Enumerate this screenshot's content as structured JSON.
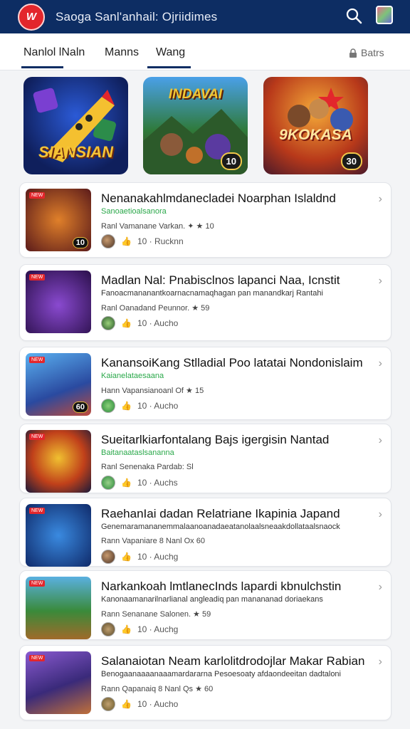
{
  "header": {
    "logo_text": "W",
    "title": "Saoga Sanl'anhail: Ojriidimes"
  },
  "tabs": [
    {
      "label": "Nanlol lNaln"
    },
    {
      "label": "Manns"
    },
    {
      "label": "Wang"
    }
  ],
  "tab_side": {
    "label": "Batrs"
  },
  "featured": [
    {
      "label": "SIANSIAN",
      "badge": ""
    },
    {
      "label": "INDAVAI",
      "badge": "10"
    },
    {
      "label": "9KOKASA",
      "badge": "30"
    }
  ],
  "cards": [
    {
      "title": "Nenanakahlmdanecladei Noarphan Islaldnd",
      "sub": "Sanoaetioalsanora",
      "meta": "Ranl Vamanane Varkan. ✦ ★ 10",
      "foot": "10   ·   Rucknn",
      "badge": "10"
    },
    {
      "title": "Madlan Nal: Pnabisclnos lapanci Naa, Icnstit",
      "sub": "Fanoacmananantkoarnacnamaqhagan pan manandkarj Rantahi",
      "meta": "Ranl Oanadand Peunnor. ★ 59",
      "foot": "10   ·   Aucho",
      "badge": ""
    },
    {
      "title": "KanansoiKang Stlladial Poo latatai Nondonislaim",
      "sub": "Kaianelataesaana",
      "meta": "Hann Vapansianoanl Of ★ 15",
      "foot": "10   ·   Aucho",
      "badge": "60"
    },
    {
      "title": "Sueitarlkiarfontalang Bajs igergisin Nantad",
      "sub": "Baitanaataslsananna",
      "meta": "Ranl Senenaka Pardab: Sl",
      "foot": "10   ·   Auchs",
      "badge": ""
    },
    {
      "title": "RaehanIai dadan Relatriane Ikapinia Japand",
      "sub": "Genemaramananemmalaanoanadaeatanolaalsneaakdollataalsnaock",
      "meta": "Rann Vapaniare 8 Nanl Ox 60",
      "foot": "10   ·   Auchg",
      "badge": ""
    },
    {
      "title": "Narkankoah lmtlanecInds lapardi kbnulchstin",
      "sub": "Kanonaamanarilnarlianal angleadiq pan manananad doriaekans",
      "meta": "Rann Senanane Salonen. ★ 59",
      "foot": "10   ·   Auchg",
      "badge": ""
    },
    {
      "title": "Salanaiotan Neam karlolitdrodojlar Makar Rabian",
      "sub": "Benogaanaaaanaaamardararna Pesoesoaty afdaondeeitan dadtaloni",
      "meta": "Rann Qapanaiq 8 Nanl Qs ★ 60",
      "foot": "10   ·   Aucho",
      "badge": ""
    }
  ],
  "colors": {
    "header_bg": "#0d2d63",
    "accent": "#e3262c",
    "sub_green": "#2aa84a"
  },
  "icons": {
    "search": "search-icon",
    "user": "user-avatar",
    "chevron": "chevron-right-icon",
    "like": "thumbs-up-icon"
  }
}
